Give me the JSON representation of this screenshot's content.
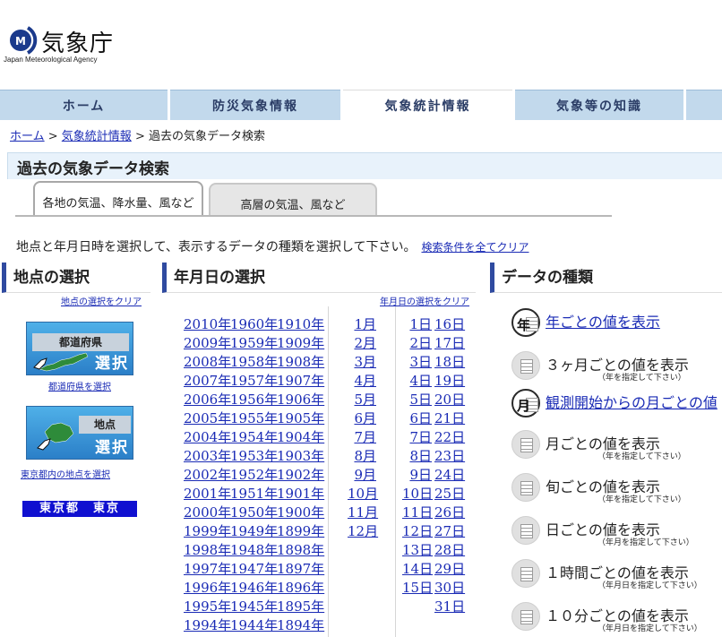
{
  "header": {
    "logo_name": "気象庁",
    "logo_sub": "Japan Meteorological Agency"
  },
  "nav": {
    "tabs": [
      "ホーム",
      "防災気象情報",
      "気象統計情報",
      "気象等の知識"
    ]
  },
  "breadcrumb": {
    "home": "ホーム",
    "sep1": " > ",
    "stats": "気象統計情報",
    "sep2": " > ",
    "current": "過去の気象データ検索"
  },
  "page_title": "過去の気象データ検索",
  "subtabs": [
    "各地の気温、降水量、風など",
    "高層の気温、風など"
  ],
  "instruction": {
    "text": "地点と年月日時を選択して、表示するデータの種類を選択して下さい。",
    "clear_all": "検索条件を全てクリア"
  },
  "location": {
    "heading": "地点の選択",
    "clear": "地点の選択をクリア",
    "pref_button": {
      "tag": "都道府県",
      "select": "選択"
    },
    "pref_link": "都道府県を選択",
    "point_button": {
      "tag": "地点",
      "select": "選択"
    },
    "point_link": "東京都内の地点を選択",
    "selected_station": "東京都　東京"
  },
  "date": {
    "heading": "年月日の選択",
    "clear": "年月日の選択をクリア",
    "years_col1": [
      "2010年",
      "2009年",
      "2008年",
      "2007年",
      "2006年",
      "2005年",
      "2004年",
      "2003年",
      "2002年",
      "2001年",
      "2000年",
      "1999年",
      "1998年",
      "1997年",
      "1996年",
      "1995年",
      "1994年"
    ],
    "years_col2": [
      "1960年",
      "1959年",
      "1958年",
      "1957年",
      "1956年",
      "1955年",
      "1954年",
      "1953年",
      "1952年",
      "1951年",
      "1950年",
      "1949年",
      "1948年",
      "1947年",
      "1946年",
      "1945年",
      "1944年"
    ],
    "years_col3": [
      "1910年",
      "1909年",
      "1908年",
      "1907年",
      "1906年",
      "1905年",
      "1904年",
      "1903年",
      "1902年",
      "1901年",
      "1900年",
      "1899年",
      "1898年",
      "1897年",
      "1896年",
      "1895年",
      "1894年"
    ],
    "months": [
      "1月",
      "2月",
      "3月",
      "4月",
      "5月",
      "6月",
      "7月",
      "8月",
      "9月",
      "10月",
      "11月",
      "12月"
    ],
    "days_col1": [
      "1日",
      "2日",
      "3日",
      "4日",
      "5日",
      "6日",
      "7日",
      "8日",
      "9日",
      "10日",
      "11日",
      "12日",
      "13日",
      "14日",
      "15日"
    ],
    "days_col2": [
      "16日",
      "17日",
      "18日",
      "19日",
      "20日",
      "21日",
      "22日",
      "23日",
      "24日",
      "25日",
      "26日",
      "27日",
      "28日",
      "29日",
      "30日",
      "31日"
    ]
  },
  "datatype": {
    "heading": "データの種類",
    "items": [
      {
        "label": "年ごとの値を表示",
        "icon": "年",
        "note": ""
      },
      {
        "label": "３ヶ月ごとの値を表示",
        "icon": "",
        "note": "（年を指定して下さい）"
      },
      {
        "label": "観測開始からの月ごとの値",
        "icon": "月",
        "note": ""
      },
      {
        "label": "月ごとの値を表示",
        "icon": "",
        "note": "（年を指定して下さい）"
      },
      {
        "label": "旬ごとの値を表示",
        "icon": "",
        "note": "（年を指定して下さい）"
      },
      {
        "label": "日ごとの値を表示",
        "icon": "",
        "note": "（年月を指定して下さい）"
      },
      {
        "label": "１時間ごとの値を表示",
        "icon": "",
        "note": "（年月日を指定して下さい）"
      },
      {
        "label": "１０分ごとの値を表示",
        "icon": "",
        "note": "（年月日を指定して下さい）"
      }
    ]
  }
}
